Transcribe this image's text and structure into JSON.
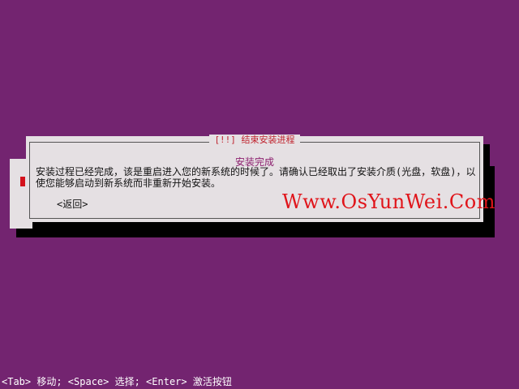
{
  "dialog": {
    "title": "[!!] 结束安装进程",
    "subtitle": "安装完成",
    "message": "安装过程已经完成，该是重启进入您的新系统的时候了。请确认已经取出了安装介质(光盘，软盘)，以使您能够启动到新系统而非重新开始安装。",
    "back_label": "<返回>"
  },
  "watermark": "Www.OsYunWei.Com",
  "help_bar": "<Tab> 移动; <Space> 选择; <Enter> 激活按钮",
  "colors": {
    "background": "#732470",
    "dialog": "#e5e0e3",
    "title": "#c0242f",
    "subtitle": "#8c1e6e",
    "watermark": "#e0141a"
  }
}
